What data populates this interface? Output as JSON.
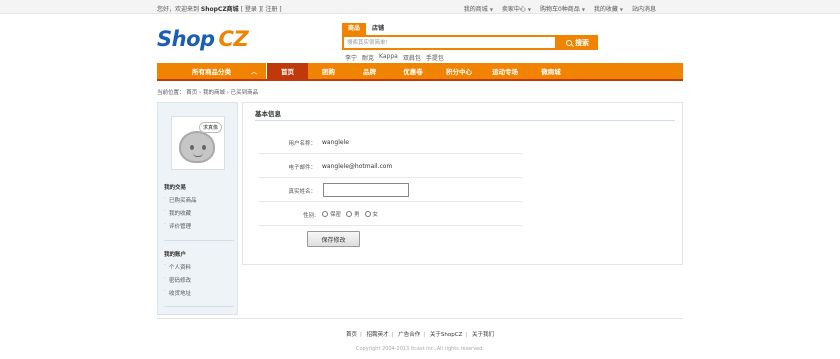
{
  "topbar": {
    "welcome_prefix": "您好，欢迎来到 ",
    "welcome_site": "ShopCZ商城",
    "login_link": "登录",
    "register_link": "注册",
    "links": [
      {
        "label": "我的商城"
      },
      {
        "label": "卖家中心"
      },
      {
        "label": "购物车0种商品"
      },
      {
        "label": "我的收藏"
      },
      {
        "label": "站内消息"
      }
    ]
  },
  "logo": {
    "part1": "Shop",
    "part2": "CZ"
  },
  "search": {
    "tabs": [
      "商品",
      "店铺"
    ],
    "placeholder": "搜索其实很简单!",
    "button_label": "搜索",
    "hot_words": [
      "李宁",
      "耐克",
      "Kappa",
      "双肩包",
      "手提包"
    ]
  },
  "nav": {
    "all_categories": "所有商品分类",
    "items": [
      "首页",
      "团购",
      "品牌",
      "优惠卷",
      "积分中心",
      "运动专场",
      "微商城"
    ]
  },
  "breadcrumb": "当前位置：  首页 › 我的商城 › 已买到商品",
  "sidebar": {
    "avatar_bubble": "求真像",
    "groups": [
      {
        "title": "我的交易",
        "items": [
          "已购买商品",
          "我的收藏",
          "评价管理"
        ]
      },
      {
        "title": "我的账户",
        "items": [
          "个人资料",
          "密码修改",
          "收货地址"
        ]
      }
    ]
  },
  "panel": {
    "title": "基本信息",
    "username_label": "用户名称：",
    "username_value": "wanglele",
    "email_label": "电子邮件：",
    "email_value": "wanglele@hotmail.com",
    "realname_label": "真实姓名：",
    "gender_label": "性别:",
    "gender_options": [
      "保密",
      "男",
      "女"
    ],
    "save_label": "保存修改"
  },
  "footer": {
    "links": [
      "首页",
      "招聘英才",
      "广告合作",
      "关于ShopCZ",
      "关于我们"
    ],
    "copyright": "Copyright 2004-2013 itcast Inc.,All rights reserved."
  },
  "colors": {
    "accent": "#f08300",
    "nav_active": "#c0390b",
    "logo_blue": "#1a5fb4"
  }
}
